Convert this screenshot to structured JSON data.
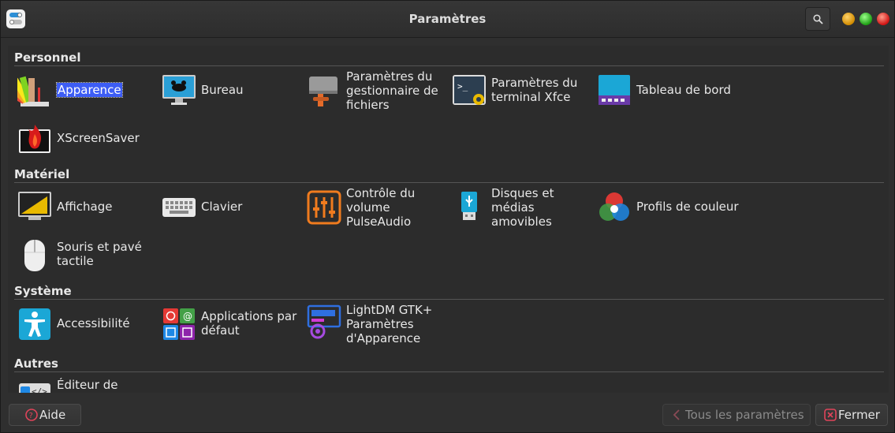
{
  "window": {
    "title": "Paramètres"
  },
  "sections": [
    {
      "title": "Personnel",
      "items": [
        {
          "label": "Apparence",
          "icon": "appearance-palette-icon"
        },
        {
          "label": "Bureau",
          "icon": "desktop-mouse-icon"
        },
        {
          "label_lines": [
            "Paramètres du",
            "gestionnaire de",
            "fichiers"
          ],
          "icon": "file-manager-settings-icon"
        },
        {
          "label_lines": [
            "Paramètres du",
            "terminal Xfce"
          ],
          "icon": "terminal-settings-icon"
        },
        {
          "label": "Tableau de bord",
          "icon": "panel-icon"
        },
        {
          "label": "XScreenSaver",
          "icon": "screensaver-flame-icon"
        }
      ]
    },
    {
      "title": "Matériel",
      "items": [
        {
          "label": "Affichage",
          "icon": "display-icon"
        },
        {
          "label": "Clavier",
          "icon": "keyboard-icon"
        },
        {
          "label_lines": [
            "Contrôle du",
            "volume",
            "PulseAudio"
          ],
          "icon": "volume-sliders-icon"
        },
        {
          "label_lines": [
            "Disques et",
            "médias",
            "amovibles"
          ],
          "icon": "usb-drive-icon"
        },
        {
          "label": "Profils de couleur",
          "icon": "color-profiles-icon"
        },
        {
          "label_lines": [
            "Souris et pavé",
            "tactile"
          ],
          "icon": "mouse-icon"
        }
      ]
    },
    {
      "title": "Système",
      "items": [
        {
          "label": "Accessibilité",
          "icon": "accessibility-icon"
        },
        {
          "label_lines": [
            "Applications par",
            "défaut"
          ],
          "icon": "default-apps-icon"
        },
        {
          "label_lines": [
            "LightDM GTK+",
            "Paramètres",
            "d'Apparence"
          ],
          "icon": "lightdm-settings-icon"
        }
      ]
    },
    {
      "title": "Autres",
      "items": [
        {
          "label_lines": [
            "Éditeur de"
          ],
          "icon": "editor-icon"
        }
      ]
    }
  ],
  "buttons": {
    "help": "Aide",
    "all_settings": "Tous les paramètres",
    "close": "Fermer"
  },
  "colors": {
    "selection": "#3d5df5",
    "background": "#2f2f2f"
  }
}
